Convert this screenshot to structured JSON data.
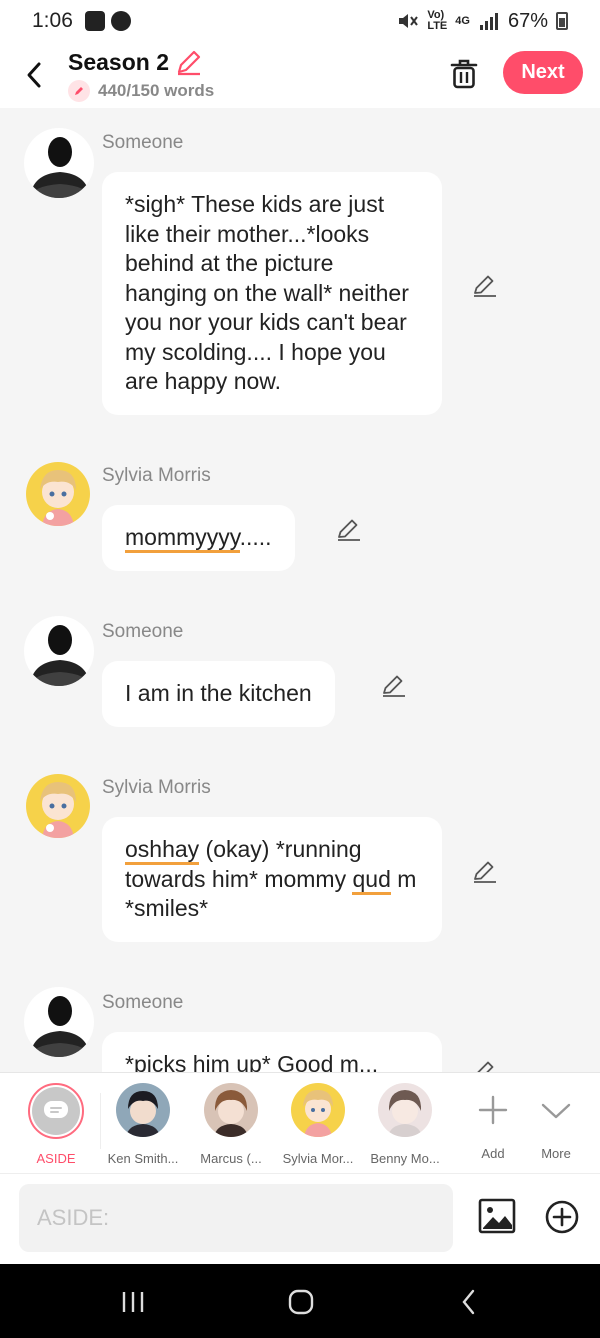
{
  "status": {
    "time": "1:06",
    "signal_top": "Vo)",
    "signal_bottom": "LTE",
    "net_top": "4G",
    "battery": "67%"
  },
  "header": {
    "title": "Season 2",
    "words": "440/150 words",
    "next_label": "Next"
  },
  "messages": [
    {
      "sender": "Someone",
      "text": "*sigh* These kids are just like their mother...*looks behind at the picture hanging on the wall* neither you nor your kids can't bear my scolding.... I hope you are happy now."
    },
    {
      "sender": "Sylvia Morris",
      "text_underlined": "mommyyyy",
      "text_rest": "....."
    },
    {
      "sender": "Someone",
      "text": "I am in the kitchen"
    },
    {
      "sender": "Sylvia Morris",
      "text_u1": "oshhay",
      "text_mid": " (okay) *running towards him* mommy ",
      "text_u2": "qud",
      "text_end": " m *smiles*"
    },
    {
      "sender": "Someone",
      "text": "*picks him up* Good m..."
    }
  ],
  "characters": [
    {
      "label": "ASIDE"
    },
    {
      "label": "Ken Smith..."
    },
    {
      "label": "Marcus (..."
    },
    {
      "label": "Sylvia Mor..."
    },
    {
      "label": "Benny Mo..."
    }
  ],
  "actions": {
    "add_label": "Add",
    "more_label": "More"
  },
  "input": {
    "placeholder": "ASIDE:"
  },
  "colors": {
    "accent": "#ff4d6a",
    "underline": "#f2a03c",
    "background": "#f5f5f5"
  }
}
